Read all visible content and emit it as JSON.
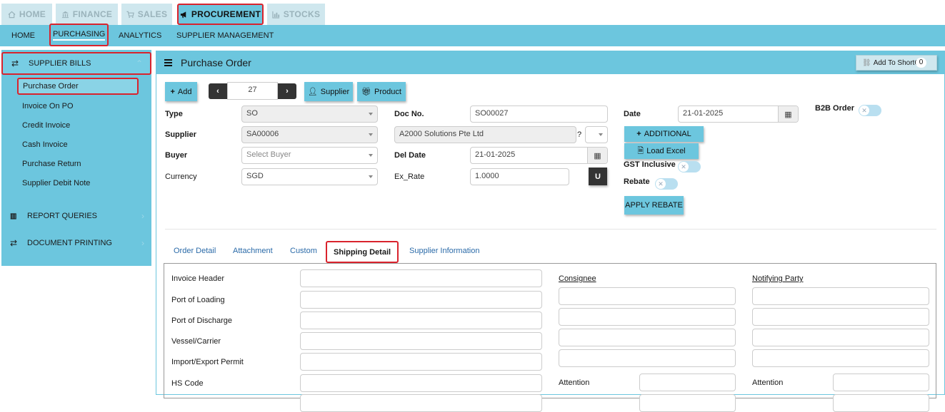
{
  "top_tabs": [
    {
      "label": "HOME",
      "icon": "home-icon"
    },
    {
      "label": "FINANCE",
      "icon": "bank-icon"
    },
    {
      "label": "SALES",
      "icon": "cart-icon"
    },
    {
      "label": "PROCUREMENT",
      "icon": "megaphone-icon"
    },
    {
      "label": "STOCKS",
      "icon": "bar-chart-icon"
    }
  ],
  "sub_nav": [
    "HOME",
    "PURCHASING",
    "ANALYTICS",
    "SUPPLIER MANAGEMENT"
  ],
  "sidebar": {
    "sections": [
      {
        "label": "SUPPLIER BILLS",
        "icon": "exchange-icon"
      },
      {
        "label": "REPORT QUERIES",
        "icon": "bar-chart-icon"
      },
      {
        "label": "DOCUMENT PRINTING",
        "icon": "exchange-icon"
      }
    ],
    "items": [
      "Purchase Order",
      "Invoice On PO",
      "Credit Invoice",
      "Cash Invoice",
      "Purchase Return",
      "Supplier Debit Note"
    ]
  },
  "panel": {
    "title": "Purchase Order",
    "shortcut_label": "Add To ShortCut",
    "shortcut_count": "0"
  },
  "toolbar": {
    "add": "Add",
    "record_no": "27",
    "supplier": "Supplier",
    "product": "Product"
  },
  "form": {
    "type_label": "Type",
    "type_value": "SO",
    "supplier_label": "Supplier",
    "supplier_value": "SA00006",
    "buyer_label": "Buyer",
    "buyer_placeholder": "Select Buyer",
    "currency_label": "Currency",
    "currency_value": "SGD",
    "docno_label": "Doc No.",
    "docno_value": "SO00027",
    "supplier_name": "A2000 Solutions Pte Ltd",
    "question_mark": "?",
    "deldate_label": "Del Date",
    "deldate_value": "21-01-2025",
    "exrate_label": "Ex_Rate",
    "exrate_value": "1.0000",
    "u_button": "U",
    "date_label": "Date",
    "date_value": "21-01-2025",
    "additional": "ADDITIONAL",
    "load_excel": "Load Excel",
    "gst_label": "GST Inclusive",
    "rebate_label": "Rebate",
    "apply_rebate": "APPLY REBATE",
    "b2b_label": "B2B Order"
  },
  "tabs": [
    "Order Detail",
    "Attachment",
    "Custom",
    "Shipping Detail",
    "Supplier Information"
  ],
  "shipping": {
    "left_labels": [
      "Invoice Header",
      "Port of Loading",
      "Port of Discharge",
      "Vessel/Carrier",
      "Import/Export Permit",
      "HS Code"
    ],
    "consignee": "Consignee",
    "notifying_party": "Notifying Party",
    "attention": "Attention"
  }
}
